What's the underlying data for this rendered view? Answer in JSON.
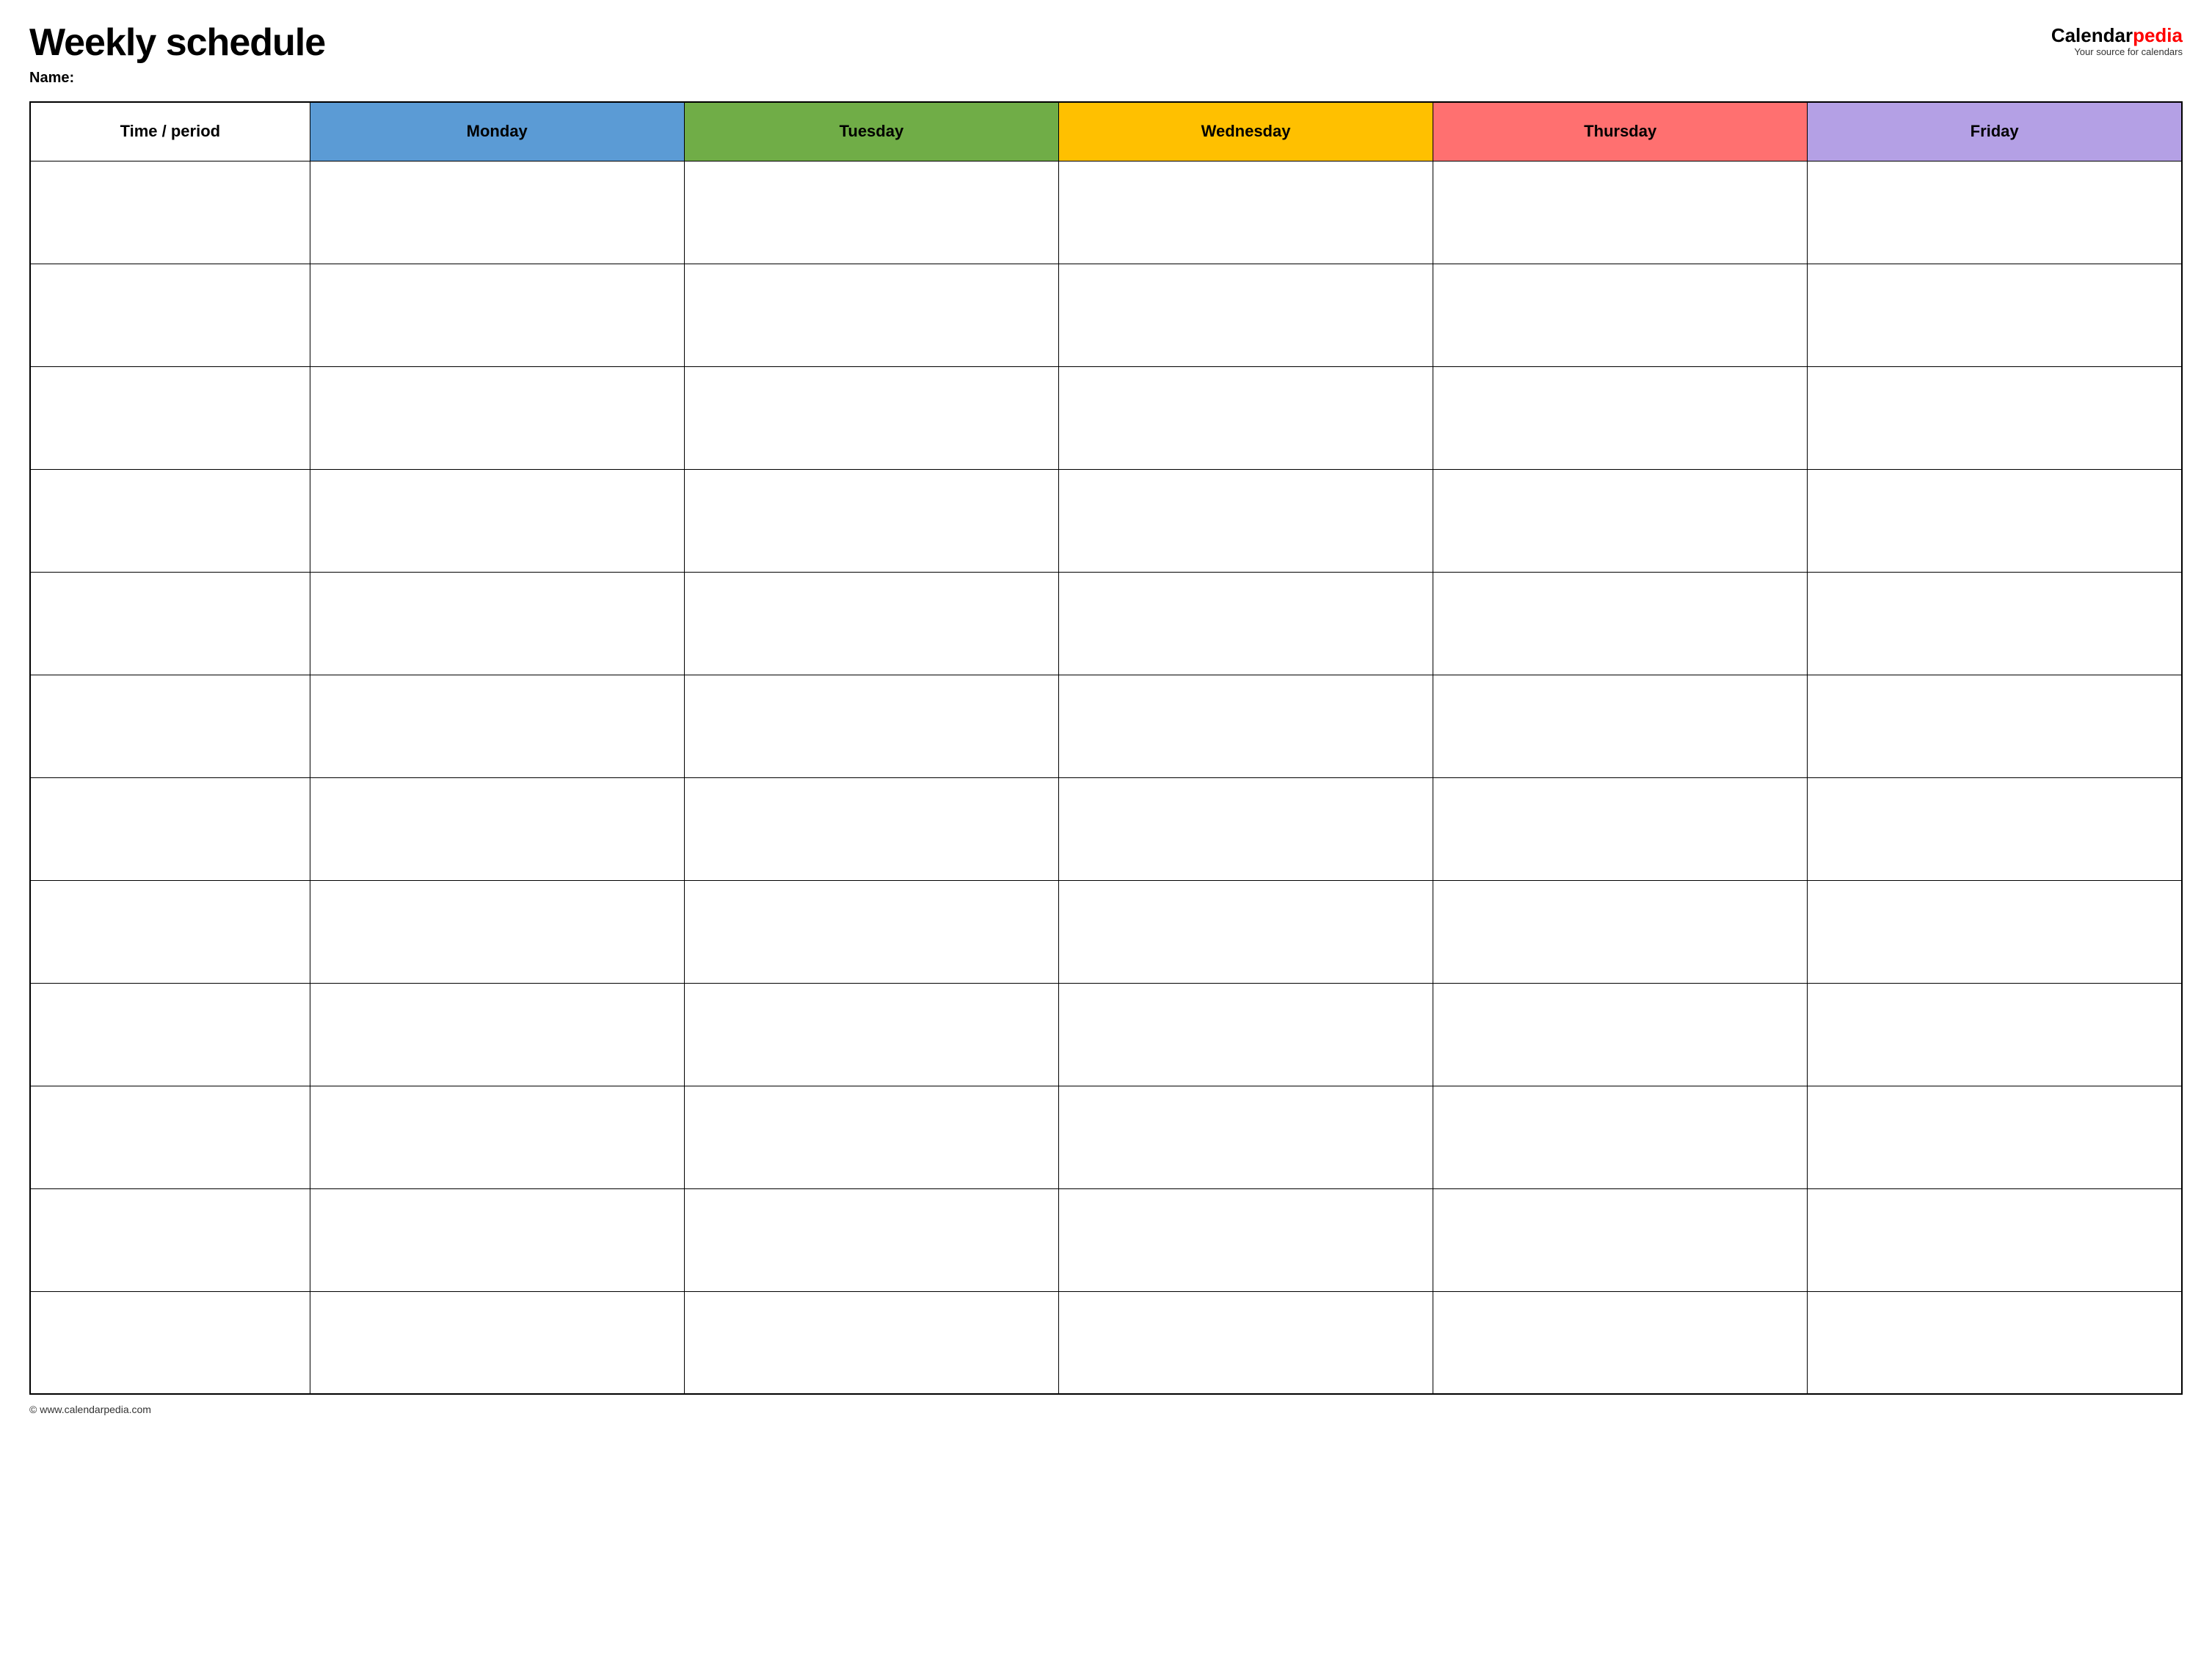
{
  "header": {
    "title": "Weekly schedule",
    "name_label": "Name:",
    "logo": {
      "calendar_text": "Calendar",
      "pedia_text": "pedia",
      "tagline": "Your source for calendars"
    }
  },
  "table": {
    "columns": [
      {
        "key": "time",
        "label": "Time / period",
        "color": "#ffffff",
        "class": "th-time"
      },
      {
        "key": "monday",
        "label": "Monday",
        "color": "#5b9bd5",
        "class": "th-monday"
      },
      {
        "key": "tuesday",
        "label": "Tuesday",
        "color": "#70ad47",
        "class": "th-tuesday"
      },
      {
        "key": "wednesday",
        "label": "Wednesday",
        "color": "#ffc000",
        "class": "th-wednesday"
      },
      {
        "key": "thursday",
        "label": "Thursday",
        "color": "#ff7070",
        "class": "th-thursday"
      },
      {
        "key": "friday",
        "label": "Friday",
        "color": "#b4a0e5",
        "class": "th-friday"
      }
    ],
    "row_count": 12
  },
  "footer": {
    "url": "© www.calendarpedia.com"
  }
}
